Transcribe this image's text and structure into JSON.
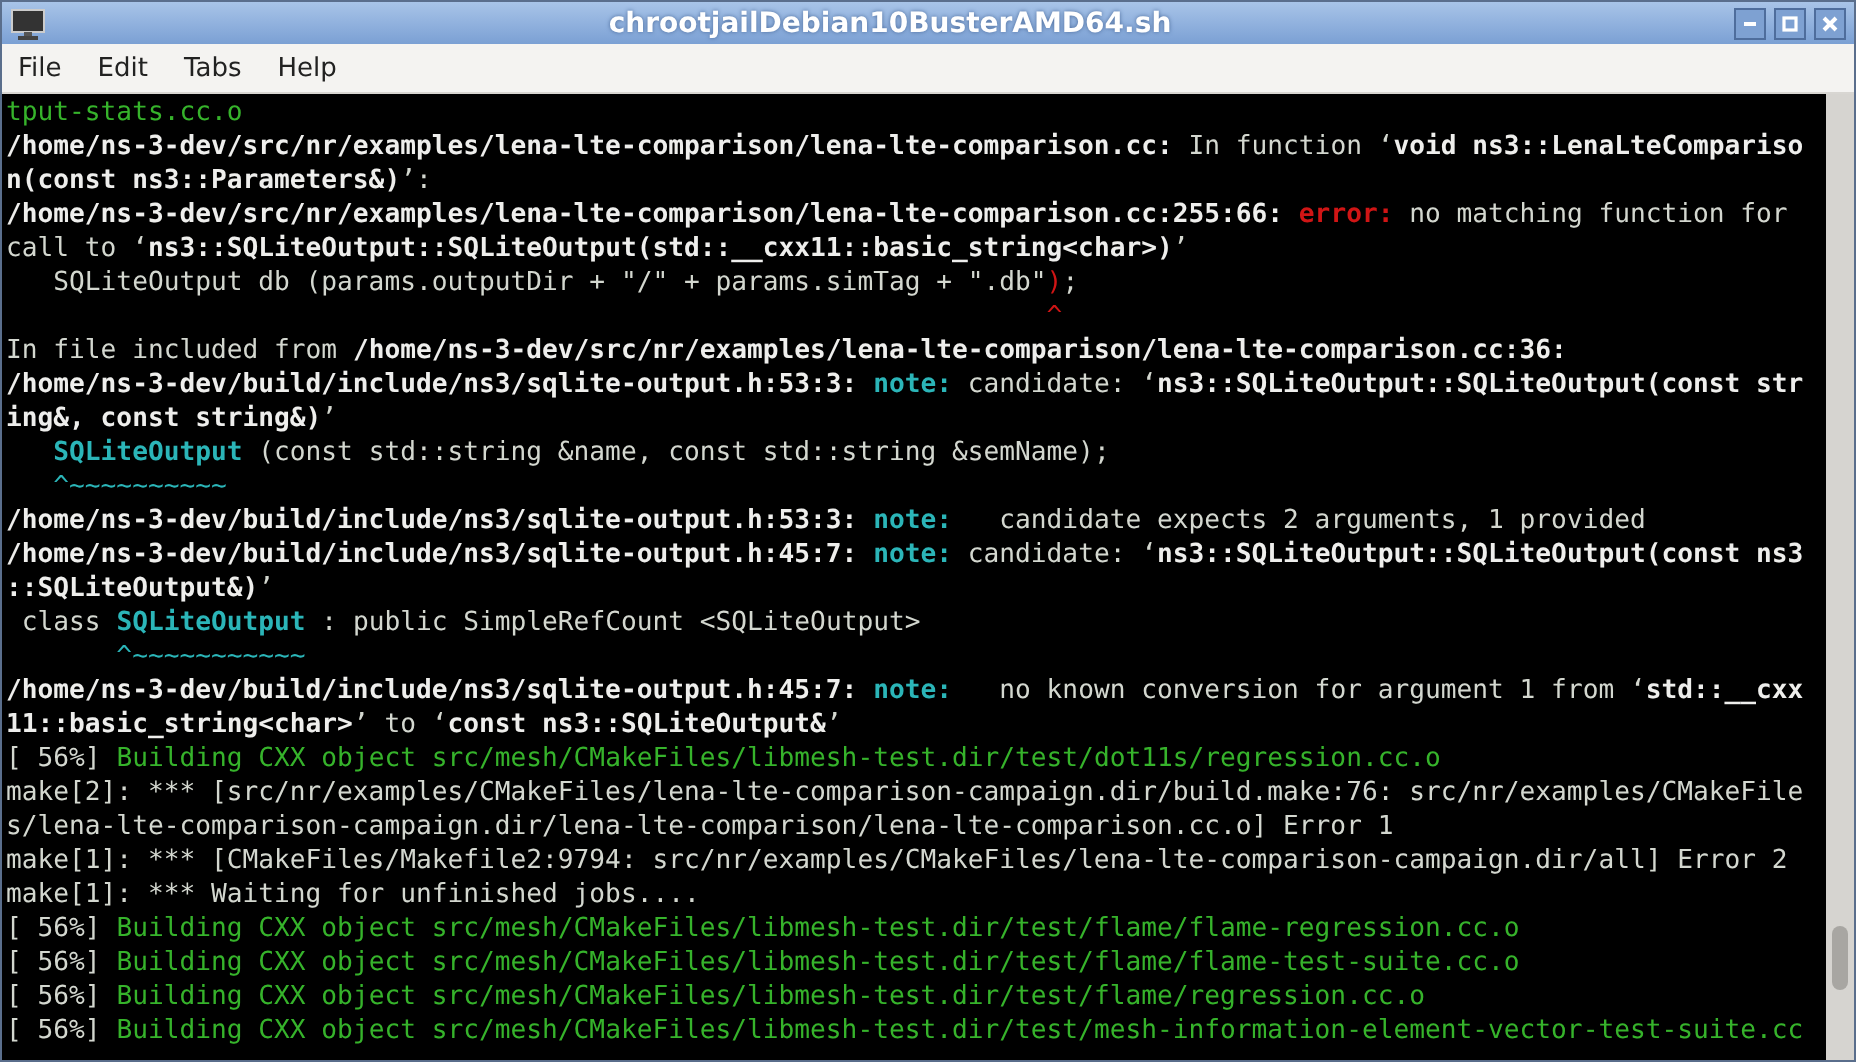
{
  "window": {
    "title": "chrootjailDebian10BusterAMD64.sh"
  },
  "menu": [
    "File",
    "Edit",
    "Tabs",
    "Help"
  ],
  "terminal": {
    "lines": [
      {
        "segments": [
          {
            "kind": "green",
            "text": "tput-stats.cc.o"
          }
        ]
      },
      {
        "segments": [
          {
            "kind": "bold",
            "text": "/home/ns-3-dev/src/nr/examples/lena-lte-comparison/lena-lte-comparison.cc:"
          },
          {
            "kind": "plain",
            "text": " In function ‘"
          },
          {
            "kind": "bold",
            "text": "void ns3::LenaLteCompariso"
          }
        ]
      },
      {
        "segments": [
          {
            "kind": "bold",
            "text": "n(const ns3::Parameters&)"
          },
          {
            "kind": "plain",
            "text": "’:"
          }
        ]
      },
      {
        "segments": [
          {
            "kind": "bold",
            "text": "/home/ns-3-dev/src/nr/examples/lena-lte-comparison/lena-lte-comparison.cc:255:66: "
          },
          {
            "kind": "error",
            "text": "error:"
          },
          {
            "kind": "plain",
            "text": " no matching function for"
          }
        ]
      },
      {
        "segments": [
          {
            "kind": "plain",
            "text": "call to ‘"
          },
          {
            "kind": "bold",
            "text": "ns3::SQLiteOutput::SQLiteOutput(std::__cxx11::basic_string<char>)"
          },
          {
            "kind": "plain",
            "text": "’"
          }
        ]
      },
      {
        "segments": [
          {
            "kind": "plain",
            "text": "   SQLiteOutput db (params.outputDir + \"/\" + params.simTag + \".db\""
          },
          {
            "kind": "red",
            "text": ")"
          },
          {
            "kind": "plain",
            "text": ";"
          }
        ]
      },
      {
        "segments": [
          {
            "kind": "red",
            "text": "                                                                  ^"
          }
        ]
      },
      {
        "segments": [
          {
            "kind": "plain",
            "text": "In file included from "
          },
          {
            "kind": "bold",
            "text": "/home/ns-3-dev/src/nr/examples/lena-lte-comparison/lena-lte-comparison.cc:36:"
          }
        ]
      },
      {
        "segments": [
          {
            "kind": "bold",
            "text": "/home/ns-3-dev/build/include/ns3/sqlite-output.h:53:3: "
          },
          {
            "kind": "note",
            "text": "note:"
          },
          {
            "kind": "plain",
            "text": " candidate: ‘"
          },
          {
            "kind": "bold",
            "text": "ns3::SQLiteOutput::SQLiteOutput(const str"
          }
        ]
      },
      {
        "segments": [
          {
            "kind": "bold",
            "text": "ing&, const string&)"
          },
          {
            "kind": "plain",
            "text": "’"
          }
        ]
      },
      {
        "segments": [
          {
            "kind": "note",
            "text": "   SQLiteOutput"
          },
          {
            "kind": "plain",
            "text": " (const std::string &name, const std::string &semName);"
          }
        ]
      },
      {
        "segments": [
          {
            "kind": "cyan",
            "text": "   ^~~~~~~~~~~"
          }
        ]
      },
      {
        "segments": [
          {
            "kind": "bold",
            "text": "/home/ns-3-dev/build/include/ns3/sqlite-output.h:53:3: "
          },
          {
            "kind": "note",
            "text": "note:"
          },
          {
            "kind": "plain",
            "text": "   candidate expects 2 arguments, 1 provided"
          }
        ]
      },
      {
        "segments": [
          {
            "kind": "bold",
            "text": "/home/ns-3-dev/build/include/ns3/sqlite-output.h:45:7: "
          },
          {
            "kind": "note",
            "text": "note:"
          },
          {
            "kind": "plain",
            "text": " candidate: ‘"
          },
          {
            "kind": "bold",
            "text": "ns3::SQLiteOutput::SQLiteOutput(const ns3"
          }
        ]
      },
      {
        "segments": [
          {
            "kind": "bold",
            "text": "::SQLiteOutput&)"
          },
          {
            "kind": "plain",
            "text": "’"
          }
        ]
      },
      {
        "segments": [
          {
            "kind": "plain",
            "text": " class "
          },
          {
            "kind": "note",
            "text": "SQLiteOutput"
          },
          {
            "kind": "plain",
            "text": " : public SimpleRefCount <SQLiteOutput>"
          }
        ]
      },
      {
        "segments": [
          {
            "kind": "cyan",
            "text": "       ^~~~~~~~~~~~"
          }
        ]
      },
      {
        "segments": [
          {
            "kind": "bold",
            "text": "/home/ns-3-dev/build/include/ns3/sqlite-output.h:45:7: "
          },
          {
            "kind": "note",
            "text": "note:"
          },
          {
            "kind": "plain",
            "text": "   no known conversion for argument 1 from ‘"
          },
          {
            "kind": "bold",
            "text": "std::__cxx"
          }
        ]
      },
      {
        "segments": [
          {
            "kind": "bold",
            "text": "11::basic_string<char>"
          },
          {
            "kind": "plain",
            "text": "’ to ‘"
          },
          {
            "kind": "bold",
            "text": "const ns3::SQLiteOutput&"
          },
          {
            "kind": "plain",
            "text": "’"
          }
        ]
      },
      {
        "segments": [
          {
            "kind": "plain",
            "text": "[ 56%] "
          },
          {
            "kind": "green",
            "text": "Building CXX object src/mesh/CMakeFiles/libmesh-test.dir/test/dot11s/regression.cc.o"
          }
        ]
      },
      {
        "segments": [
          {
            "kind": "plain",
            "text": "make[2]: *** [src/nr/examples/CMakeFiles/lena-lte-comparison-campaign.dir/build.make:76: src/nr/examples/CMakeFile"
          }
        ]
      },
      {
        "segments": [
          {
            "kind": "plain",
            "text": "s/lena-lte-comparison-campaign.dir/lena-lte-comparison/lena-lte-comparison.cc.o] Error 1"
          }
        ]
      },
      {
        "segments": [
          {
            "kind": "plain",
            "text": "make[1]: *** [CMakeFiles/Makefile2:9794: src/nr/examples/CMakeFiles/lena-lte-comparison-campaign.dir/all] Error 2"
          }
        ]
      },
      {
        "segments": [
          {
            "kind": "plain",
            "text": "make[1]: *** Waiting for unfinished jobs...."
          }
        ]
      },
      {
        "segments": [
          {
            "kind": "plain",
            "text": "[ 56%] "
          },
          {
            "kind": "green",
            "text": "Building CXX object src/mesh/CMakeFiles/libmesh-test.dir/test/flame/flame-regression.cc.o"
          }
        ]
      },
      {
        "segments": [
          {
            "kind": "plain",
            "text": "[ 56%] "
          },
          {
            "kind": "green",
            "text": "Building CXX object src/mesh/CMakeFiles/libmesh-test.dir/test/flame/flame-test-suite.cc.o"
          }
        ]
      },
      {
        "segments": [
          {
            "kind": "plain",
            "text": "[ 56%] "
          },
          {
            "kind": "green",
            "text": "Building CXX object src/mesh/CMakeFiles/libmesh-test.dir/test/flame/regression.cc.o"
          }
        ]
      },
      {
        "segments": [
          {
            "kind": "plain",
            "text": "[ 56%] "
          },
          {
            "kind": "green",
            "text": "Building CXX object src/mesh/CMakeFiles/libmesh-test.dir/test/mesh-information-element-vector-test-suite.cc"
          }
        ]
      }
    ]
  }
}
